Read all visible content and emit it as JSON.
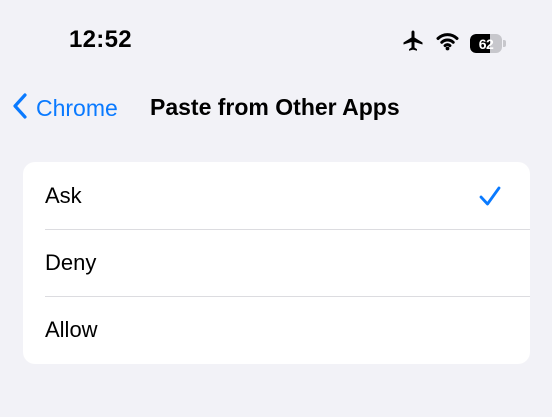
{
  "status_bar": {
    "time": "12:52",
    "battery_level": 62,
    "battery_text": "62",
    "icons": [
      "airplane-mode-icon",
      "wifi-icon",
      "battery-icon"
    ]
  },
  "nav": {
    "back_label": "Chrome",
    "title": "Paste from Other Apps"
  },
  "options": [
    {
      "label": "Ask",
      "selected": true
    },
    {
      "label": "Deny",
      "selected": false
    },
    {
      "label": "Allow",
      "selected": false
    }
  ],
  "colors": {
    "accent": "#0a7aff",
    "background": "#f2f2f7",
    "card": "#ffffff",
    "separator": "#dcdce0"
  }
}
